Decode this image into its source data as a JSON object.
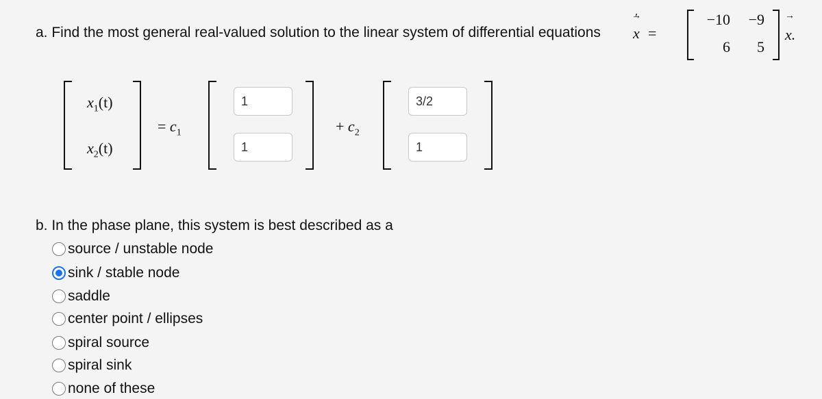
{
  "part_a": {
    "prompt": "a. Find the most general real-valued solution to the linear system of differential equations",
    "lhs_var": "x",
    "prime": "′",
    "equals": "=",
    "matrix": [
      [
        "−10",
        "−9"
      ],
      [
        "6",
        "5"
      ]
    ],
    "rhs_var": "x.",
    "vector_arrow": "→"
  },
  "solution": {
    "x1": "x",
    "x1_sub": "1",
    "x1_arg": "(t)",
    "x2": "x",
    "x2_sub": "2",
    "x2_arg": "(t)",
    "equals_c1": "= ",
    "c1": "c",
    "c1_sub": "1",
    "plus_c2": "+ ",
    "c2": "c",
    "c2_sub": "2",
    "v1": [
      "1",
      "1"
    ],
    "v2": [
      "3/2",
      "1"
    ]
  },
  "part_b": {
    "prompt": "b. In the phase plane, this system is best described as a",
    "options": [
      {
        "label": "source / unstable node",
        "selected": false
      },
      {
        "label": "sink / stable node",
        "selected": true
      },
      {
        "label": "saddle",
        "selected": false
      },
      {
        "label": "center point / ellipses",
        "selected": false
      },
      {
        "label": "spiral source",
        "selected": false
      },
      {
        "label": "spiral sink",
        "selected": false
      },
      {
        "label": "none of these",
        "selected": false
      }
    ]
  },
  "colors": {
    "radio_selected": "#1a73e8",
    "background": "#f4f4f4"
  }
}
